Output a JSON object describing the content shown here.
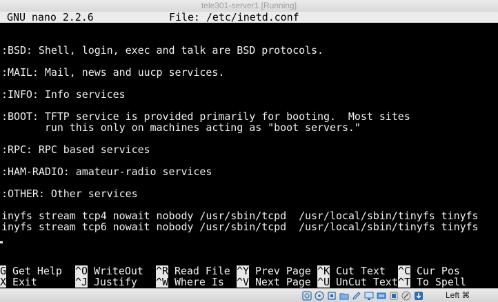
{
  "window": {
    "title": "tele301-server1 [Running]"
  },
  "nano": {
    "version": "GNU nano 2.2.6",
    "file": "File: /etc/inetd.conf"
  },
  "content_lines": [
    ":BSD: Shell, login, exec and talk are BSD protocols.",
    ":MAIL: Mail, news and uucp services.",
    ":INFO: Info services",
    ":BOOT: TFTP service is provided primarily for booting.  Most sites",
    "       run this only on machines acting as \"boot servers.\"",
    ":RPC: RPC based services",
    ":HAM-RADIO: amateur-radio services",
    ":OTHER: Other services",
    "inyfs stream tcp4 nowait nobody /usr/sbin/tcpd  /usr/local/sbin/tinyfs tinyfs",
    "inyfs stream tcp6 nowait nobody /usr/sbin/tcpd  /usr/local/sbin/tinyfs tinyfs"
  ],
  "shortcuts": [
    {
      "key": "G",
      "label": " Get Help"
    },
    {
      "key": "^O",
      "label": " WriteOut"
    },
    {
      "key": "^R",
      "label": " Read File"
    },
    {
      "key": "^Y",
      "label": " Prev Page"
    },
    {
      "key": "^K",
      "label": " Cut Text"
    },
    {
      "key": "^C",
      "label": " Cur Pos"
    },
    {
      "key": "X",
      "label": " Exit"
    },
    {
      "key": "^J",
      "label": " Justify"
    },
    {
      "key": "^W",
      "label": " Where Is"
    },
    {
      "key": "^V",
      "label": " Next Page"
    },
    {
      "key": "^U",
      "label": " UnCut Text"
    },
    {
      "key": "^T",
      "label": " To Spell"
    }
  ],
  "statusbar": {
    "icons": [
      "cd-icon",
      "optical-icon",
      "usb-icon",
      "shared-folder-icon",
      "pencil-icon",
      "display-icon",
      "network-icon",
      "video-capture-icon",
      "mouse-integration-icon",
      "download-icon"
    ],
    "host_key": "Left ⌘"
  }
}
